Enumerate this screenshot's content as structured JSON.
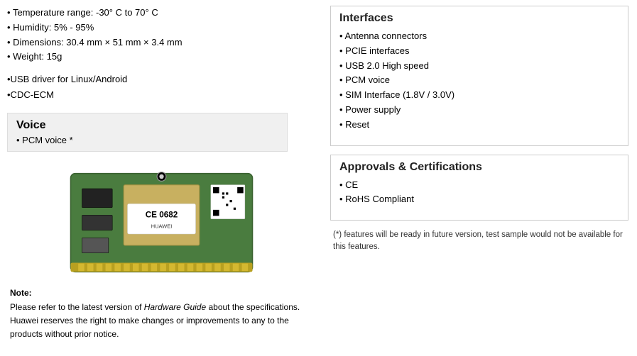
{
  "left": {
    "specs": [
      "Temperature range:   -30°  C to 70°  C",
      "Humidity:  5% -  95%",
      "Dimensions:  30.4 mm × 51 mm × 3.4 mm",
      "Weight:   15g"
    ],
    "drivers": [
      "•USB driver for Linux/Android",
      "•CDC-ECM"
    ],
    "voice_title": "Voice",
    "voice_items": [
      "PCM voice *"
    ],
    "note_label": "Note:",
    "note_text": "Please refer to the latest version of ",
    "note_guide": "Hardware Guide",
    "note_rest": " about the specifications. Huawei reserves the right to make changes or improvements to any to the products without prior notice."
  },
  "right": {
    "interfaces_title": "Interfaces",
    "interfaces_items": [
      "Antenna  connectors",
      "PCIE interfaces",
      "USB 2.0 High speed",
      "PCM voice",
      "SIM Interface (1.8V / 3.0V)",
      "Power supply",
      "Reset"
    ],
    "approvals_title": "Approvals & Certifications",
    "approvals_items": [
      "CE",
      "RoHS Compliant"
    ],
    "feature_note": "(*) features will be ready in future version, test sample would not be available for this features."
  }
}
